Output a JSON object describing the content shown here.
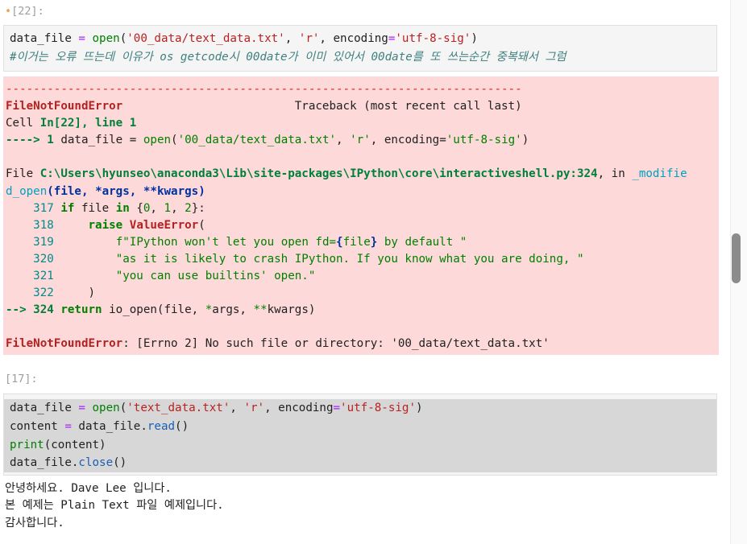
{
  "cells": [
    {
      "prompt": "[22]:",
      "code_lines": [
        [
          [
            "data_file ",
            ""
          ],
          [
            "=",
            "o"
          ],
          [
            " ",
            ""
          ],
          [
            "open",
            "b"
          ],
          [
            "(",
            ""
          ],
          [
            "'00_data/text_data.txt'",
            "s"
          ],
          [
            ", ",
            ""
          ],
          [
            "'r'",
            "s"
          ],
          [
            ", encoding",
            ""
          ],
          [
            "=",
            "o"
          ],
          [
            "'utf-8-sig'",
            "s"
          ],
          [
            ")",
            ""
          ]
        ],
        [
          [
            "#이거는 오류 뜨는데 이유가 os getcode시 00date가 이미 있어서 00date를 또 쓰는순간 중복돼서 그럼",
            "c"
          ]
        ]
      ],
      "error_lines": [
        [
          [
            "---------------------------------------------------------------------------",
            "red"
          ]
        ],
        [
          [
            "FileNotFoundError",
            "er"
          ],
          [
            "                         Traceback (most recent call last)",
            ""
          ]
        ],
        [
          [
            "Cell ",
            ""
          ],
          [
            "In[22], line 1",
            "gr"
          ]
        ],
        [
          [
            "----> 1 ",
            "gr"
          ],
          [
            "data_file ",
            ""
          ],
          [
            "=",
            ""
          ],
          [
            " ",
            ""
          ],
          [
            "open",
            "kn"
          ],
          [
            "(",
            ""
          ],
          [
            "'00_data/text_data.txt'",
            "kn"
          ],
          [
            ", ",
            ""
          ],
          [
            "'r'",
            "kn"
          ],
          [
            ", encoding",
            ""
          ],
          [
            "=",
            ""
          ],
          [
            "'utf-8-sig'",
            "kn"
          ],
          [
            ")",
            ""
          ]
        ],
        [
          [
            "",
            ""
          ]
        ],
        [
          [
            "File ",
            ""
          ],
          [
            "C:\\Users\\hyunseo\\anaconda3\\Lib\\site-packages\\IPython\\core\\interactiveshell.py:324",
            "gr"
          ],
          [
            ", in ",
            ""
          ],
          [
            "_modifie",
            "cy"
          ]
        ],
        [
          [
            "d_open",
            "cy"
          ],
          [
            "(",
            "bl"
          ],
          [
            "file",
            "bl"
          ],
          [
            ", ",
            "bl"
          ],
          [
            "*args",
            "bl"
          ],
          [
            ", ",
            "bl"
          ],
          [
            "**kwargs",
            "bl"
          ],
          [
            ")",
            "bl"
          ]
        ],
        [
          [
            "    317 ",
            "lnum"
          ],
          [
            "if",
            "k"
          ],
          [
            " file ",
            ""
          ],
          [
            "in",
            "k"
          ],
          [
            " {",
            ""
          ],
          [
            "0",
            "kn"
          ],
          [
            ", ",
            ""
          ],
          [
            "1",
            "kn"
          ],
          [
            ", ",
            ""
          ],
          [
            "2",
            "kn"
          ],
          [
            "}:",
            ""
          ]
        ],
        [
          [
            "    318 ",
            "lnum"
          ],
          [
            "    ",
            ""
          ],
          [
            "raise",
            "k"
          ],
          [
            " ",
            ""
          ],
          [
            "ValueError",
            "er"
          ],
          [
            "(",
            ""
          ]
        ],
        [
          [
            "    319 ",
            "lnum"
          ],
          [
            "        ",
            ""
          ],
          [
            "f",
            "kn"
          ],
          [
            "\"IPython won't let you open fd=",
            "kn"
          ],
          [
            "{",
            "bl"
          ],
          [
            "file",
            "kn"
          ],
          [
            "}",
            "bl"
          ],
          [
            " by default \"",
            "kn"
          ]
        ],
        [
          [
            "    320 ",
            "lnum"
          ],
          [
            "        ",
            ""
          ],
          [
            "\"as it is likely to crash IPython. If you know what you are doing, \"",
            "kn"
          ]
        ],
        [
          [
            "    321 ",
            "lnum"
          ],
          [
            "        ",
            ""
          ],
          [
            "\"you can use builtins' open.\"",
            "kn"
          ]
        ],
        [
          [
            "    322 ",
            "lnum"
          ],
          [
            "    )",
            ""
          ]
        ],
        [
          [
            "--> 324 ",
            "gr"
          ],
          [
            "return",
            "k"
          ],
          [
            " io_open(file, ",
            ""
          ],
          [
            "*",
            "kn"
          ],
          [
            "args, ",
            ""
          ],
          [
            "**",
            "kn"
          ],
          [
            "kwargs)",
            ""
          ]
        ],
        [
          [
            "",
            ""
          ]
        ],
        [
          [
            "FileNotFoundError",
            "er"
          ],
          [
            ": [Errno 2] No such file or directory: '00_data/text_data.txt'",
            ""
          ]
        ]
      ]
    },
    {
      "prompt": "[17]:",
      "code_lines": [
        [
          [
            "data_file ",
            ""
          ],
          [
            "=",
            "o"
          ],
          [
            " ",
            ""
          ],
          [
            "open",
            "b"
          ],
          [
            "(",
            ""
          ],
          [
            "'text_data.txt'",
            "s"
          ],
          [
            ", ",
            ""
          ],
          [
            "'r'",
            "s"
          ],
          [
            ", encoding",
            ""
          ],
          [
            "=",
            "o"
          ],
          [
            "'utf-8-sig'",
            "s"
          ],
          [
            ")",
            ""
          ]
        ],
        [
          [
            "content ",
            ""
          ],
          [
            "=",
            "o"
          ],
          [
            " data_file",
            ""
          ],
          [
            ".",
            ""
          ],
          [
            "read",
            "m"
          ],
          [
            "()",
            ""
          ]
        ],
        [
          [
            "print",
            "b"
          ],
          [
            "(content)",
            ""
          ]
        ],
        [
          [
            "data_file",
            ""
          ],
          [
            ".",
            ""
          ],
          [
            "close",
            "m"
          ],
          [
            "()",
            ""
          ]
        ]
      ],
      "output_lines": [
        "안녕하세요. Dave Lee 입니다.",
        "본 예제는 Plain Text 파일 예제입니다.",
        "감사합니다."
      ]
    }
  ]
}
